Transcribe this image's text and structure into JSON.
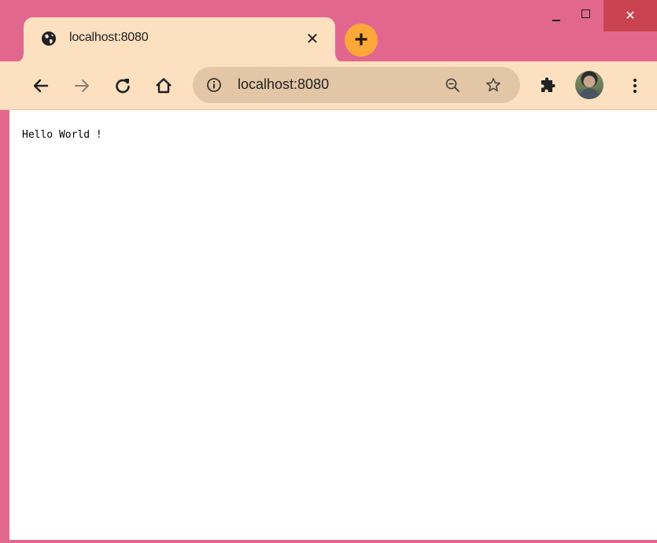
{
  "tab": {
    "title": "localhost:8080",
    "close_glyph": "✕",
    "favicon": "globe-icon"
  },
  "new_tab": {
    "glyph": "+"
  },
  "window_controls": {
    "minimize": "minimize-icon",
    "maximize": "maximize-icon",
    "close_glyph": "✕"
  },
  "toolbar": {
    "back": "back-arrow-icon",
    "forward": "forward-arrow-icon",
    "reload": "reload-icon",
    "home": "home-icon"
  },
  "omnibox": {
    "url": "localhost:8080",
    "info_icon": "info-icon",
    "zoom_icon": "zoom-out-icon",
    "star_icon": "star-icon"
  },
  "extensions": {
    "icon": "puzzle-icon"
  },
  "profile": {
    "icon": "avatar"
  },
  "menu": {
    "icon": "kebab-menu-icon"
  },
  "page": {
    "body_text": "Hello World !"
  },
  "colors": {
    "frame": "#e2678f",
    "tab_bg": "#fde0c0",
    "toolbar_bg": "#fde0c0",
    "omnibox_bg": "#e3c6a6",
    "new_tab_bg": "#ffa83a",
    "close_button_bg": "#ca4350",
    "content_bg": "#ffffff"
  }
}
